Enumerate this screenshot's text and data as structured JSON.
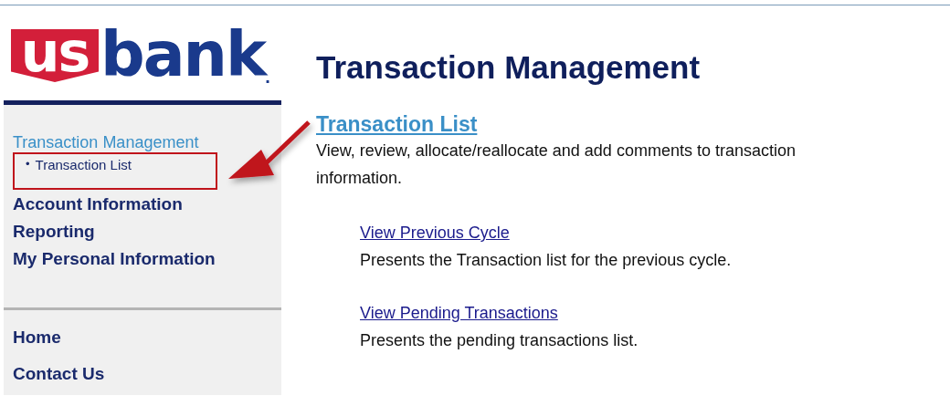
{
  "logo": {
    "badge": "us",
    "word": "bank",
    "mark": "."
  },
  "sidebar": {
    "nav": [
      {
        "label": "Transaction Management",
        "kind": "section",
        "selected": true
      },
      {
        "label": "Transaction List",
        "kind": "subitem",
        "bullet": "•",
        "selected": false
      },
      {
        "label": "Account Information",
        "kind": "item",
        "selected": false
      },
      {
        "label": "Reporting",
        "kind": "item",
        "selected": false
      },
      {
        "label": "My Personal Information",
        "kind": "item",
        "selected": false
      }
    ],
    "footer_links": [
      "Home",
      "Contact Us"
    ]
  },
  "page": {
    "title": "Transaction Management",
    "section": {
      "link": "Transaction List",
      "description": "View, review, allocate/reallocate and add comments to transaction information."
    },
    "options": [
      {
        "link": "View Previous Cycle",
        "description": "Presents the Transaction list for the previous cycle."
      },
      {
        "link": "View Pending Transactions",
        "description": "Presents the pending transactions list."
      }
    ]
  }
}
